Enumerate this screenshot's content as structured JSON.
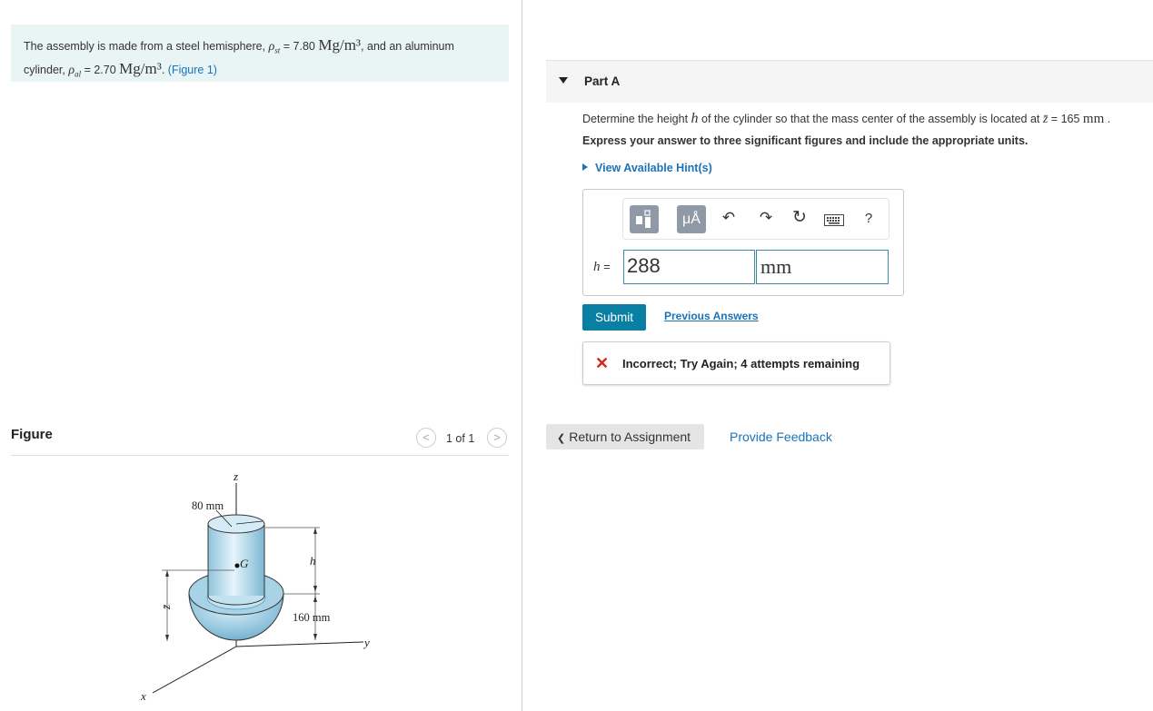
{
  "problem": {
    "text1": "The assembly is made from a steel hemisphere, ",
    "rho_st_symbol": "ρ",
    "rho_st_sub": "st",
    "rho_st_eq": " = 7.80 ",
    "rho_st_unit": "Mg/m³",
    "text2": ", and an aluminum",
    "text3": "cylinder, ",
    "rho_al_symbol": "ρ",
    "rho_al_sub": "al",
    "rho_al_eq": " = 2.70 ",
    "rho_al_unit": "Mg/m³",
    "text4": ". ",
    "figure_link": "(Figure 1)"
  },
  "figure_panel": {
    "title": "Figure",
    "prev": "<",
    "next": ">",
    "counter": "1 of 1",
    "labels": {
      "z_axis": "z",
      "radius": "80 mm",
      "G": "G",
      "h": "h",
      "zbar": "z̄",
      "hemi": "160 mm",
      "y_axis": "y",
      "x_axis": "x"
    }
  },
  "part_a": {
    "label": "Part A",
    "question_pre": "Determine the height ",
    "question_var": "h",
    "question_mid": " of the cylinder so that the mass center of the assembly is located at ",
    "question_zbar": "z̄",
    "question_eq": " = 165 ",
    "question_unit": "mm",
    "question_end": " .",
    "instruction": "Express your answer to three significant figures and include the appropriate units.",
    "hints": "View Available Hint(s)",
    "toolbar": {
      "units_button": "μÅ",
      "undo": "↶",
      "redo": "↷",
      "reset": "↻",
      "help": "?"
    },
    "answer_label_var": "h",
    "answer_label_eq": " =",
    "answer_value": "288",
    "answer_units": "mm",
    "submit": "Submit",
    "previous_answers": "Previous Answers",
    "feedback_icon": "✕",
    "feedback": "Incorrect; Try Again; 4 attempts remaining"
  },
  "footer": {
    "return_label": "Return to Assignment",
    "return_icon": "❮",
    "provide_feedback": "Provide Feedback"
  },
  "colors": {
    "accent_link": "#1a73b8",
    "submit_bg": "#087fa3",
    "problem_bg": "#e9f4f5",
    "error": "#d0271d"
  }
}
